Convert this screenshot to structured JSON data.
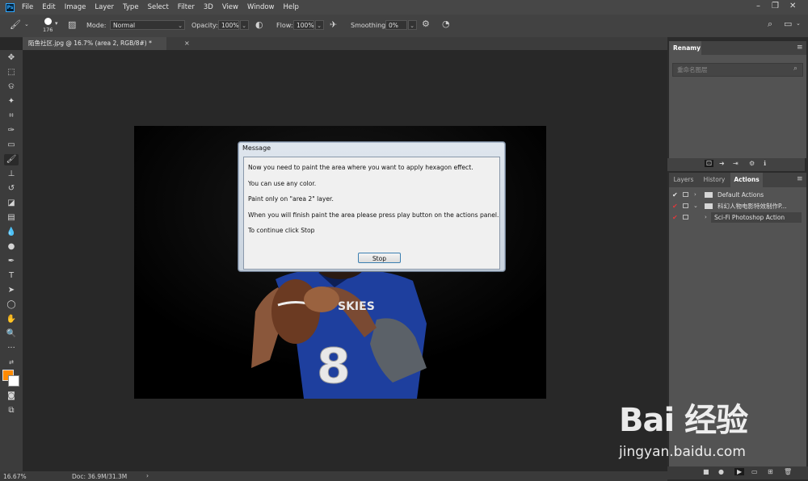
{
  "menu": {
    "logo": "Ps",
    "items": [
      "File",
      "Edit",
      "Image",
      "Layer",
      "Type",
      "Select",
      "Filter",
      "3D",
      "View",
      "Window",
      "Help"
    ]
  },
  "options": {
    "brush_size": "176",
    "mode_label": "Mode:",
    "mode_value": "Normal",
    "opacity_label": "Opacity:",
    "opacity_value": "100%",
    "flow_label": "Flow:",
    "flow_value": "100%",
    "smoothing_label": "Smoothing:",
    "smoothing_value": "0%"
  },
  "document_tab": {
    "title": "陌鱼社区.jpg @ 16.7% (area 2, RGB/8#) *",
    "close": "×"
  },
  "dialog": {
    "title": "Message",
    "lines": [
      "Now you need to paint the area where you want to apply hexagon effect.",
      "You can use any color.",
      "Paint only on \"area 2\" layer.",
      "When you will finish paint the area please press play button on the actions panel.",
      "To continue click Stop"
    ],
    "button": "Stop"
  },
  "canvas": {
    "jersey_text": "SKIES",
    "jersey_number": "8"
  },
  "status": {
    "zoom": "16.67%",
    "doc": "Doc: 36.9M/31.3M",
    "arrow": "›"
  },
  "libraries": {
    "tab": "Renamy",
    "search_placeholder": "重命名图层"
  },
  "actions_panel": {
    "tabs": [
      "Layers",
      "History",
      "Actions"
    ],
    "rows": [
      {
        "label": "Default Actions"
      },
      {
        "label": "科幻人物电影特效制作P..."
      },
      {
        "label": "Sci-Fi Photoshop Action"
      }
    ]
  },
  "watermark": {
    "logo": "Bai 经验",
    "url": "jingyan.baidu.com"
  },
  "colors": {
    "foreground": "#ff8a00",
    "background": "#ffffff",
    "jersey_blue": "#1e3f9e"
  }
}
